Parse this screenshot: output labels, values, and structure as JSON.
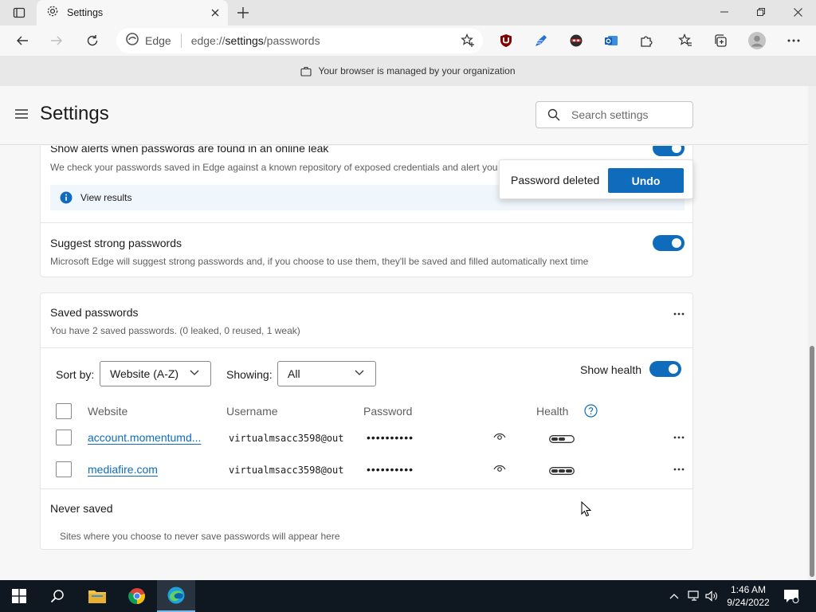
{
  "browser": {
    "tab_title": "Settings",
    "address_brand": "Edge",
    "url_prefix": "edge://",
    "url_bold": "settings",
    "url_suffix": "/passwords",
    "managed_text": "Your browser is managed by your organization"
  },
  "settings": {
    "title": "Settings",
    "search_placeholder": "Search settings"
  },
  "leak_section": {
    "title": "Show alerts when passwords are found in an online leak",
    "description": "We check your passwords saved in Edge against a known repository of exposed credentials and alert you if",
    "view_results": "View results"
  },
  "suggest_section": {
    "title": "Suggest strong passwords",
    "description": "Microsoft Edge will suggest strong passwords and, if you choose to use them, they'll be saved and filled automatically next time"
  },
  "saved_passwords": {
    "title": "Saved passwords",
    "summary": "You have 2 saved passwords. (0 leaked, 0 reused, 1 weak)",
    "sort_label": "Sort by:",
    "sort_value": "Website (A-Z)",
    "showing_label": "Showing:",
    "showing_value": "All",
    "show_health_label": "Show health",
    "columns": {
      "website": "Website",
      "username": "Username",
      "password": "Password",
      "health": "Health"
    },
    "rows": [
      {
        "website": "account.momentumd...",
        "username": "virtualmsacc3598@out",
        "password": "••••••••••"
      },
      {
        "website": "mediafire.com",
        "username": "virtualmsacc3598@out",
        "password": "••••••••••"
      }
    ]
  },
  "never_saved": {
    "title": "Never saved",
    "description": "Sites where you choose to never save passwords will appear here"
  },
  "toast": {
    "message": "Password deleted",
    "action": "Undo"
  },
  "taskbar": {
    "time": "1:46 AM",
    "date": "9/24/2022"
  },
  "colors": {
    "accent": "#0f6cbd",
    "taskbar": "#0f1720"
  }
}
